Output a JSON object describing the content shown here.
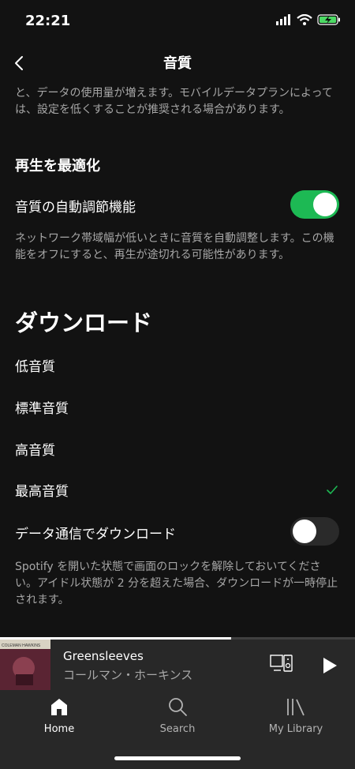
{
  "status": {
    "time": "22:21"
  },
  "header": {
    "title": "音質"
  },
  "content": {
    "top_desc": "と、データの使用量が増えます。モバイルデータプランによっては、設定を低くすることが推奨される場合があります。",
    "section_playback": "再生を最適化",
    "auto_adjust_label": "音質の自動調節機能",
    "auto_adjust_on": true,
    "auto_adjust_desc": "ネットワーク帯域幅が低いときに音質を自動調整します。この機能をオフにすると、再生が途切れる可能性があります。",
    "download_heading": "ダウンロード",
    "quality_options": [
      "低音質",
      "標準音質",
      "高音質",
      "最高音質"
    ],
    "selected_quality": "最高音質",
    "cellular_label": "データ通信でダウンロード",
    "cellular_on": false,
    "cellular_desc": "Spotify を開いた状態で画面のロックを解除しておいてください。アイドル状態が 2 分を超えた場合、ダウンロードが一時停止されます。"
  },
  "player": {
    "title": "Greensleeves",
    "artist": "コールマン・ホーキンス",
    "progress": 0.65,
    "album_art_text": "COLEMAN HAWKINS"
  },
  "tabs": [
    {
      "label": "Home",
      "icon": "home-icon",
      "active": true
    },
    {
      "label": "Search",
      "icon": "search-icon",
      "active": false
    },
    {
      "label": "My Library",
      "icon": "library-icon",
      "active": false
    }
  ],
  "colors": {
    "accent": "#1db954",
    "background": "#121212",
    "player": "#282828"
  }
}
